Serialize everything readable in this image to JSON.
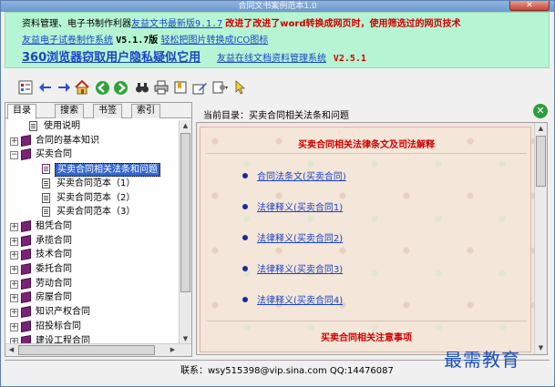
{
  "window": {
    "title": "合同文书案例范本1.0",
    "close_glyph": "✕"
  },
  "banner": {
    "line1_prefix": "资料管理、电子书制作利器",
    "line1_link": "友益文书最新版9.1.7",
    "line1_red": "改进了改进了word转换成网页时，使用筛选过的网页技术",
    "line2_link1": "友益电子试卷制作系统",
    "line2_version": "V5.1.7版",
    "line2_link2": "轻松把图片转换成ICO图标",
    "line3_big": "360浏览器窃取用户隐私疑似它用",
    "line3_link": "友益在线文档资料管理系统",
    "line3_version": "V2.5.1"
  },
  "toolbar": {
    "icons": [
      "tree-toggle-icon",
      "back-arrow-icon",
      "forward-arrow-icon",
      "home-icon",
      "prev-green-icon",
      "next-green-icon",
      "find-binoculars-icon",
      "print-icon",
      "bookmark-icon",
      "edit-icon",
      "settings-icon",
      "pointer-icon"
    ]
  },
  "tabs": [
    "目录",
    "搜索",
    "书签",
    "索引"
  ],
  "tree": [
    {
      "label": "使用说明",
      "type": "page",
      "level": 1,
      "expander": ""
    },
    {
      "label": "合同的基本知识",
      "type": "book",
      "level": 0,
      "expander": "+"
    },
    {
      "label": "买卖合同",
      "type": "book",
      "level": 0,
      "expander": "-"
    },
    {
      "label": "买卖合同相关法条和问题",
      "type": "openbook",
      "level": 2,
      "expander": "",
      "selected": true
    },
    {
      "label": "买卖合同范本（1）",
      "type": "page",
      "level": 2,
      "expander": ""
    },
    {
      "label": "买卖合同范本（2）",
      "type": "page",
      "level": 2,
      "expander": ""
    },
    {
      "label": "买卖合同范本（3）",
      "type": "page",
      "level": 2,
      "expander": ""
    },
    {
      "label": "租凭合同",
      "type": "book",
      "level": 0,
      "expander": "+"
    },
    {
      "label": "承揽合同",
      "type": "book",
      "level": 0,
      "expander": "+"
    },
    {
      "label": "技术合同",
      "type": "book",
      "level": 0,
      "expander": "+"
    },
    {
      "label": "委托合同",
      "type": "book",
      "level": 0,
      "expander": "+"
    },
    {
      "label": "劳动合同",
      "type": "book",
      "level": 0,
      "expander": "+"
    },
    {
      "label": "房屋合同",
      "type": "book",
      "level": 0,
      "expander": "+"
    },
    {
      "label": "知识产权合同",
      "type": "book",
      "level": 0,
      "expander": "+"
    },
    {
      "label": "招投标合同",
      "type": "book",
      "level": 0,
      "expander": "+"
    },
    {
      "label": "建设工程合同",
      "type": "book",
      "level": 0,
      "expander": "+"
    }
  ],
  "content": {
    "current_dir": "当前目录：买卖合同相关法条和问题",
    "section1_title": "买卖合同相关法律条文及司法解释",
    "items": [
      "合同法条文(买卖合同)",
      "法律释义(买卖合同1)",
      "法律释义(买卖合同2)",
      "法律释义(买卖合同3)",
      "法律释义(买卖合同4)"
    ],
    "section2_title": "买卖合同相关注意事项"
  },
  "status": {
    "text": "联系：wsy515398@vip.sina.com QQ:14476087"
  },
  "watermark": "最需教育",
  "colors": {
    "banner_bg": "#b6f5d3",
    "link": "#1a44c8",
    "red": "#d00000",
    "tree_selected": "#3366cc"
  }
}
